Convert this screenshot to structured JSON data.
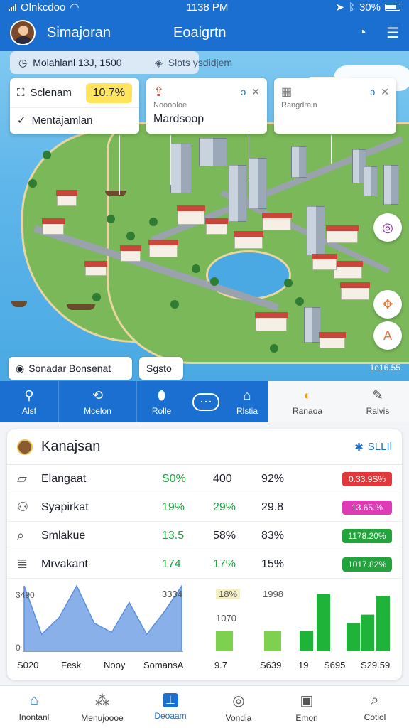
{
  "status": {
    "carrier": "Olnkcdoo",
    "time": "1138 PM",
    "battery": "30%"
  },
  "header": {
    "app_title": "Simajoran",
    "center_title": "Eoaigrtn",
    "help_icon": "help-circle-icon",
    "menu_icon": "list-menu-icon"
  },
  "map": {
    "chips": {
      "primary": "Molahlanl 13J, 1500",
      "secondary": "Slots ysdidjem"
    },
    "cards": [
      {
        "title": "Sclenam",
        "value": "10.7%",
        "sub": "Mentajamlan"
      },
      {
        "title": "Nooooloe",
        "sub": "Mardsoop"
      },
      {
        "title": "Rangdrain"
      }
    ],
    "bottom_labels": [
      "Sonadar Bonsenat",
      "Sgsto"
    ],
    "corner_text": "1e16.55"
  },
  "categories": [
    {
      "label": "Alsf",
      "icon": "pin-icon",
      "style": "blue"
    },
    {
      "label": "Mcelon",
      "icon": "route-icon",
      "style": "blue"
    },
    {
      "label": "Rolle",
      "icon": "location-icon",
      "style": "blue"
    },
    {
      "label": "",
      "icon": "chat-icon",
      "style": "blue"
    },
    {
      "label": "Rlstia",
      "icon": "home-icon",
      "style": "blue"
    },
    {
      "label": "Ranaoa",
      "icon": "sun-icon",
      "style": "light"
    },
    {
      "label": "Ralvis",
      "icon": "pen-icon",
      "style": "light"
    }
  ],
  "panel": {
    "title": "Kanajsan",
    "link": "SLLIl",
    "rows": [
      {
        "name": "Elangaat",
        "c1": "S0%",
        "c2": "400",
        "c3": "92%",
        "badge": "0.33.9S%",
        "badge_color": "#e0383b"
      },
      {
        "name": "Syapirkat",
        "c1": "19%",
        "c2": "29%",
        "c3": "29.8",
        "badge": "13.65.%",
        "badge_color": "#e03bb6"
      },
      {
        "name": "Smlakue",
        "c1": "13.5",
        "c2": "58%",
        "c3": "83%",
        "badge": "1178.20%",
        "badge_color": "#22a33c"
      },
      {
        "name": "Mrvakant",
        "c1": "174",
        "c2": "17%",
        "c3": "15%",
        "badge": "1017.82%",
        "badge_color": "#22a33c"
      }
    ],
    "chart_labels": {
      "y_top": "3490",
      "y_zero": "0",
      "mid_a": "3334",
      "mid_b": "18%",
      "mid_c": "1998",
      "mid_d": "1070"
    },
    "x_labels": [
      "S020",
      "Fesk",
      "Nooy",
      "SomansA",
      "9.7",
      "S639",
      "19",
      "S695",
      "S29.59"
    ]
  },
  "chart_data": [
    {
      "type": "area",
      "title": "",
      "x": [
        "S020",
        "Fesk",
        "Nooy",
        "SomansA"
      ],
      "series": [
        {
          "values": [
            3490,
            900,
            1800,
            3490,
            1500,
            1000,
            2600,
            900,
            2100,
            3490
          ]
        }
      ],
      "ylim": [
        0,
        3490
      ]
    },
    {
      "type": "bar",
      "categories": [
        "9.7",
        "S639"
      ],
      "values": [
        1070,
        1070
      ],
      "ylim": [
        0,
        3490
      ]
    },
    {
      "type": "bar",
      "categories": [
        "19",
        "S695",
        "S29.59"
      ],
      "values": [
        1100,
        3050,
        1500,
        1950,
        2950
      ],
      "ylim": [
        0,
        3490
      ]
    }
  ],
  "bottom_nav": [
    {
      "label": "Inontanl",
      "icon": "home-icon"
    },
    {
      "label": "Menujoooe",
      "icon": "network-icon"
    },
    {
      "label": "Deoaam",
      "icon": "document-icon",
      "active": true
    },
    {
      "label": "Vondia",
      "icon": "compass-icon"
    },
    {
      "label": "Emon",
      "icon": "inbox-icon"
    },
    {
      "label": "Cotiol",
      "icon": "search-icon"
    }
  ]
}
